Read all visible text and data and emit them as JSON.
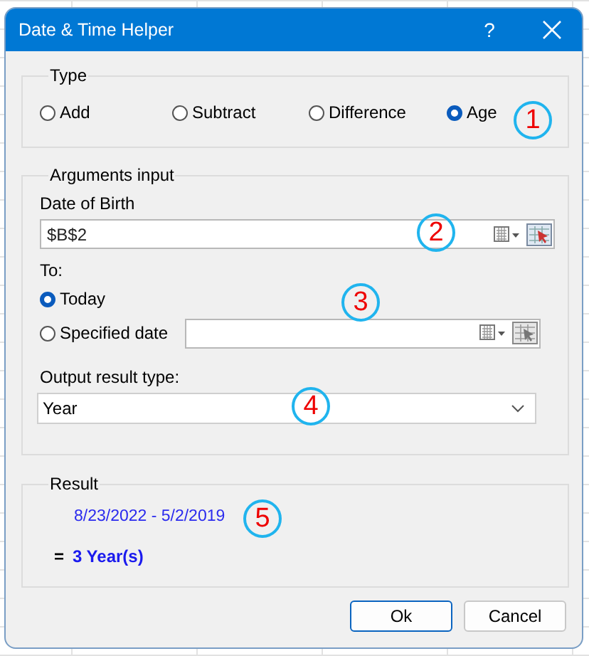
{
  "window": {
    "title": "Date & Time Helper",
    "help": "?"
  },
  "type": {
    "label": "Type",
    "callout": "1",
    "options": [
      {
        "label": "Add",
        "selected": false
      },
      {
        "label": "Subtract",
        "selected": false
      },
      {
        "label": "Difference",
        "selected": false
      },
      {
        "label": "Age",
        "selected": true
      }
    ]
  },
  "arguments": {
    "label": "Arguments input",
    "date_of_birth": {
      "label": "Date of Birth",
      "value": "$B$2",
      "callout": "2"
    },
    "to": {
      "label": "To:",
      "callout": "3",
      "options": [
        {
          "label": "Today",
          "selected": true,
          "kind": "plain"
        },
        {
          "label": "Specified date",
          "selected": false,
          "kind": "with-field"
        }
      ]
    },
    "output": {
      "label": "Output result type:",
      "value": "Year",
      "callout": "4"
    }
  },
  "result": {
    "label": "Result",
    "expression": "8/23/2022 - 5/2/2019",
    "equals": "=",
    "answer": "3 Year(s)",
    "callout": "5"
  },
  "buttons": [
    {
      "label": "Ok",
      "default": true
    },
    {
      "label": "Cancel",
      "default": false
    }
  ]
}
